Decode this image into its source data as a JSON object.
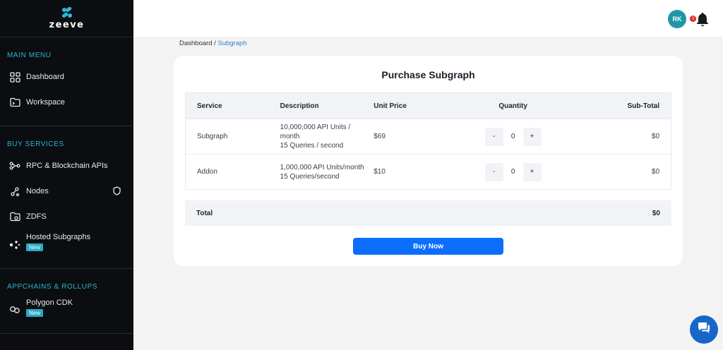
{
  "brand": {
    "name": "zeeve"
  },
  "sidebar": {
    "main_menu_title": "MAIN MENU",
    "main_items": [
      {
        "label": "Dashboard",
        "icon": "grid-icon"
      },
      {
        "label": "Workspace",
        "icon": "folder-icon"
      }
    ],
    "buy_services_title": "BUY SERVICES",
    "buy_items": [
      {
        "label": "RPC & Blockchain APIs",
        "icon": "api-icon"
      },
      {
        "label": "Nodes",
        "icon": "nodes-icon",
        "trailing_icon": "shield-icon"
      },
      {
        "label": "ZDFS",
        "icon": "storage-icon"
      },
      {
        "label": "Hosted Subgraphs",
        "icon": "subgraph-icon",
        "badge": "New"
      }
    ],
    "appchains_title": "APPCHAINS & ROLLUPS",
    "appchain_items": [
      {
        "label": "Polygon CDK",
        "icon": "chain-link-icon",
        "badge": "New"
      }
    ]
  },
  "topbar": {
    "avatar_initials": "RK",
    "notification_count": "3"
  },
  "breadcrumb": {
    "root": "Dashboard",
    "separator": " / ",
    "current": "Subgraph"
  },
  "purchase": {
    "title": "Purchase Subgraph",
    "columns": [
      "Service",
      "Description",
      "Unit Price",
      "Quantity",
      "Sub-Total"
    ],
    "rows": [
      {
        "service": "Subgraph",
        "description": [
          "10,000,000 API Units /",
          "month",
          "15 Queries / second"
        ],
        "unit_price": "$69",
        "quantity": "0",
        "subtotal": "$0"
      },
      {
        "service": "Addon",
        "description": [
          "1,000,000 API Units/month",
          "15 Queries/second"
        ],
        "unit_price": "$10",
        "quantity": "0",
        "subtotal": "$0"
      }
    ],
    "stepper_minus": "-",
    "stepper_plus": "+",
    "total_label": "Total",
    "total_value": "$0",
    "buy_label": "Buy Now"
  },
  "colors": {
    "accent": "#0d6efd",
    "sidebar_bg": "#0b0d10",
    "section_title": "#2bb6d0",
    "avatar": "#1f97a8"
  }
}
